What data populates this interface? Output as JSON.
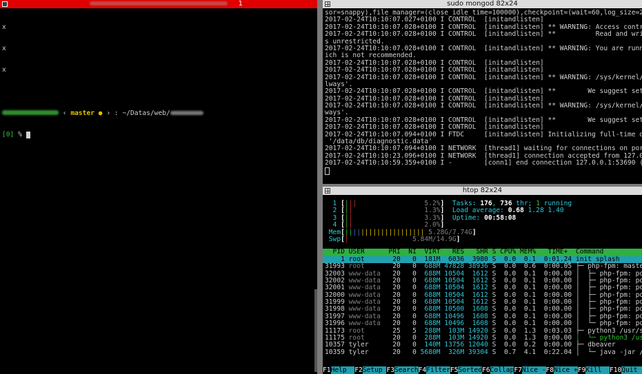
{
  "left": {
    "title": "",
    "title_num": "1",
    "lines": [
      "x",
      "x",
      "x"
    ],
    "prompt": {
      "arrow": "‹",
      "branch": "master",
      "dot": "●",
      "arrow2": "›",
      "sep": ":",
      "path": "~/Datas/web/",
      "prompt_line_prefix": "[0]",
      "prompt_symbol": "%"
    }
  },
  "mongo": {
    "title": "sudo mongod 82x24",
    "lines": [
      "sor=snappy),file_manager=(close_idle_time=100000),checkpoint=(wait=60,log_size=2GB",
      "2017-02-24T10:10:07.027+0100 I CONTROL  [initandlisten]",
      "2017-02-24T10:10:07.028+0100 I CONTROL  [initandlisten] ** WARNING: Access control",
      "2017-02-24T10:10:07.028+0100 I CONTROL  [initandlisten] **          Read and write",
      "s unrestricted.",
      "2017-02-24T10:10:07.028+0100 I CONTROL  [initandlisten] ** WARNING: You are runnin",
      "ich is not recommended.",
      "2017-02-24T10:10:07.028+0100 I CONTROL  [initandlisten]",
      "2017-02-24T10:10:07.028+0100 I CONTROL  [initandlisten]",
      "2017-02-24T10:10:07.028+0100 I CONTROL  [initandlisten] ** WARNING: /sys/kernel/mm",
      "lways'.",
      "2017-02-24T10:10:07.028+0100 I CONTROL  [initandlisten] **        We suggest setti",
      "2017-02-24T10:10:07.028+0100 I CONTROL  [initandlisten]",
      "2017-02-24T10:10:07.028+0100 I CONTROL  [initandlisten] ** WARNING: /sys/kernel/mm",
      "ways'.",
      "2017-02-24T10:10:07.028+0100 I CONTROL  [initandlisten] **        We suggest setti",
      "2017-02-24T10:10:07.028+0100 I CONTROL  [initandlisten]",
      "2017-02-24T10:10:07.094+0100 I FTDC     [initandlisten] Initializing full-time dia",
      " '/data/db/diagnostic.data'",
      "2017-02-24T10:10:07.094+0100 I NETWORK  [thread1] waiting for connections on port",
      "2017-02-24T10:10:23.096+0100 I NETWORK  [thread1] connection accepted from 127.0.0",
      "2017-02-24T10:10:59.359+0100 I -        [conn1] end connection 127.0.0.1:53690 (1"
    ]
  },
  "htop": {
    "title": "htop 82x24",
    "cpus": [
      {
        "id": "1",
        "bar": "|||",
        "pct": "5.2%"
      },
      {
        "id": "2",
        "bar": "||",
        "pct": "1.3%"
      },
      {
        "id": "3",
        "bar": "||",
        "pct": "3.3%"
      },
      {
        "id": "4",
        "bar": "||",
        "pct": "2.0%"
      }
    ],
    "mem": {
      "label": "Mem",
      "bar": "||||||||||||||||||||",
      "used": "5.28G",
      "total": "7.74G"
    },
    "swp": {
      "label": "Swp",
      "bar": "|",
      "used": "5.84M",
      "total": "14.9G"
    },
    "tasks_label": "Tasks:",
    "tasks": "176",
    "thr": "736",
    "thr_label": "thr;",
    "running": "1",
    "running_label": "running",
    "load_label": "Load average:",
    "load1": "0.68",
    "load5": "1.28",
    "load15": "1.40",
    "uptime_label": "Uptime:",
    "uptime": "00:58:08",
    "header": "  PID USER      PRI  NI  VIRT   RES   SHR S CPU% MEM%   TIME+  Command",
    "rows": [
      {
        "pid": "1",
        "user": "root",
        "pri": "20",
        "ni": "0",
        "virt": "181M",
        "res": "6036",
        "shr": "3980",
        "s": "S",
        "cpu": "0.0",
        "mem": "0.1",
        "time": "0:01.24",
        "cmd": "init splash",
        "selected": true
      },
      {
        "pid": "31993",
        "user": "root",
        "pri": "20",
        "ni": "0",
        "virt": "688M",
        "res": "47828",
        "shr": "38936",
        "s": "S",
        "cpu": "0.0",
        "mem": "0.6",
        "time": "0:00.05",
        "cmd": "├─ php-fpm: master"
      },
      {
        "pid": "32003",
        "user": "www-data",
        "pri": "20",
        "ni": "0",
        "virt": "688M",
        "res": "10504",
        "shr": "1612",
        "s": "S",
        "cpu": "0.0",
        "mem": "0.1",
        "time": "0:00.00",
        "cmd": "│  ├─ php-fpm: pool"
      },
      {
        "pid": "32002",
        "user": "www-data",
        "pri": "20",
        "ni": "0",
        "virt": "688M",
        "res": "10504",
        "shr": "1612",
        "s": "S",
        "cpu": "0.0",
        "mem": "0.1",
        "time": "0:00.00",
        "cmd": "│  ├─ php-fpm: pool"
      },
      {
        "pid": "32001",
        "user": "www-data",
        "pri": "20",
        "ni": "0",
        "virt": "688M",
        "res": "10504",
        "shr": "1612",
        "s": "S",
        "cpu": "0.0",
        "mem": "0.1",
        "time": "0:00.00",
        "cmd": "│  ├─ php-fpm: pool"
      },
      {
        "pid": "32000",
        "user": "www-data",
        "pri": "20",
        "ni": "0",
        "virt": "688M",
        "res": "10504",
        "shr": "1612",
        "s": "S",
        "cpu": "0.0",
        "mem": "0.1",
        "time": "0:00.00",
        "cmd": "│  ├─ php-fpm: pool"
      },
      {
        "pid": "31999",
        "user": "www-data",
        "pri": "20",
        "ni": "0",
        "virt": "688M",
        "res": "10504",
        "shr": "1612",
        "s": "S",
        "cpu": "0.0",
        "mem": "0.1",
        "time": "0:00.00",
        "cmd": "│  ├─ php-fpm: pool"
      },
      {
        "pid": "31998",
        "user": "www-data",
        "pri": "20",
        "ni": "0",
        "virt": "688M",
        "res": "10500",
        "shr": "1608",
        "s": "S",
        "cpu": "0.0",
        "mem": "0.1",
        "time": "0:00.00",
        "cmd": "│  ├─ php-fpm: pool"
      },
      {
        "pid": "31997",
        "user": "www-data",
        "pri": "20",
        "ni": "0",
        "virt": "688M",
        "res": "10496",
        "shr": "1608",
        "s": "S",
        "cpu": "0.0",
        "mem": "0.1",
        "time": "0:00.00",
        "cmd": "│  ├─ php-fpm: pool"
      },
      {
        "pid": "31996",
        "user": "www-data",
        "pri": "20",
        "ni": "0",
        "virt": "688M",
        "res": "10496",
        "shr": "1608",
        "s": "S",
        "cpu": "0.0",
        "mem": "0.1",
        "time": "0:00.00",
        "cmd": "│  └─ php-fpm: pool"
      },
      {
        "pid": "11173",
        "user": "root",
        "pri": "25",
        "ni": "5",
        "virt": "288M",
        "res": "103M",
        "shr": "14920",
        "s": "S",
        "cpu": "0.0",
        "mem": "1.3",
        "time": "0:03.03",
        "cmd": "├─ python3 /usr/sbi"
      },
      {
        "pid": "11175",
        "user": "root",
        "pri": "20",
        "ni": "0",
        "virt": "288M",
        "res": "103M",
        "shr": "14920",
        "s": "S",
        "cpu": "0.0",
        "mem": "1.3",
        "time": "0:00.00",
        "cmd": "│  └─ python3 /usr/"
      },
      {
        "pid": "10357",
        "user": "tyler",
        "pri": "20",
        "ni": "0",
        "virt": "140M",
        "res": "13756",
        "shr": "12040",
        "s": "S",
        "cpu": "0.0",
        "mem": "0.2",
        "time": "0:00.00",
        "cmd": "├─ dbeaver"
      },
      {
        "pid": "10359",
        "user": "tyler",
        "pri": "20",
        "ni": "0",
        "virt": "5680M",
        "res": "326M",
        "shr": "39304",
        "s": "S",
        "cpu": "0.7",
        "mem": "4.1",
        "time": "0:22.04",
        "cmd": "│  └─ java -jar /ho"
      }
    ],
    "fkeys": [
      {
        "k": "F1",
        "l": "Help  "
      },
      {
        "k": "F2",
        "l": "Setup "
      },
      {
        "k": "F3",
        "l": "Search"
      },
      {
        "k": "F4",
        "l": "Filter"
      },
      {
        "k": "F5",
        "l": "Sorted"
      },
      {
        "k": "F6",
        "l": "Collap"
      },
      {
        "k": "F7",
        "l": "Nice -"
      },
      {
        "k": "F8",
        "l": "Nice +"
      },
      {
        "k": "F9",
        "l": "Kill  "
      },
      {
        "k": "F10",
        "l": "Quit  "
      }
    ]
  }
}
